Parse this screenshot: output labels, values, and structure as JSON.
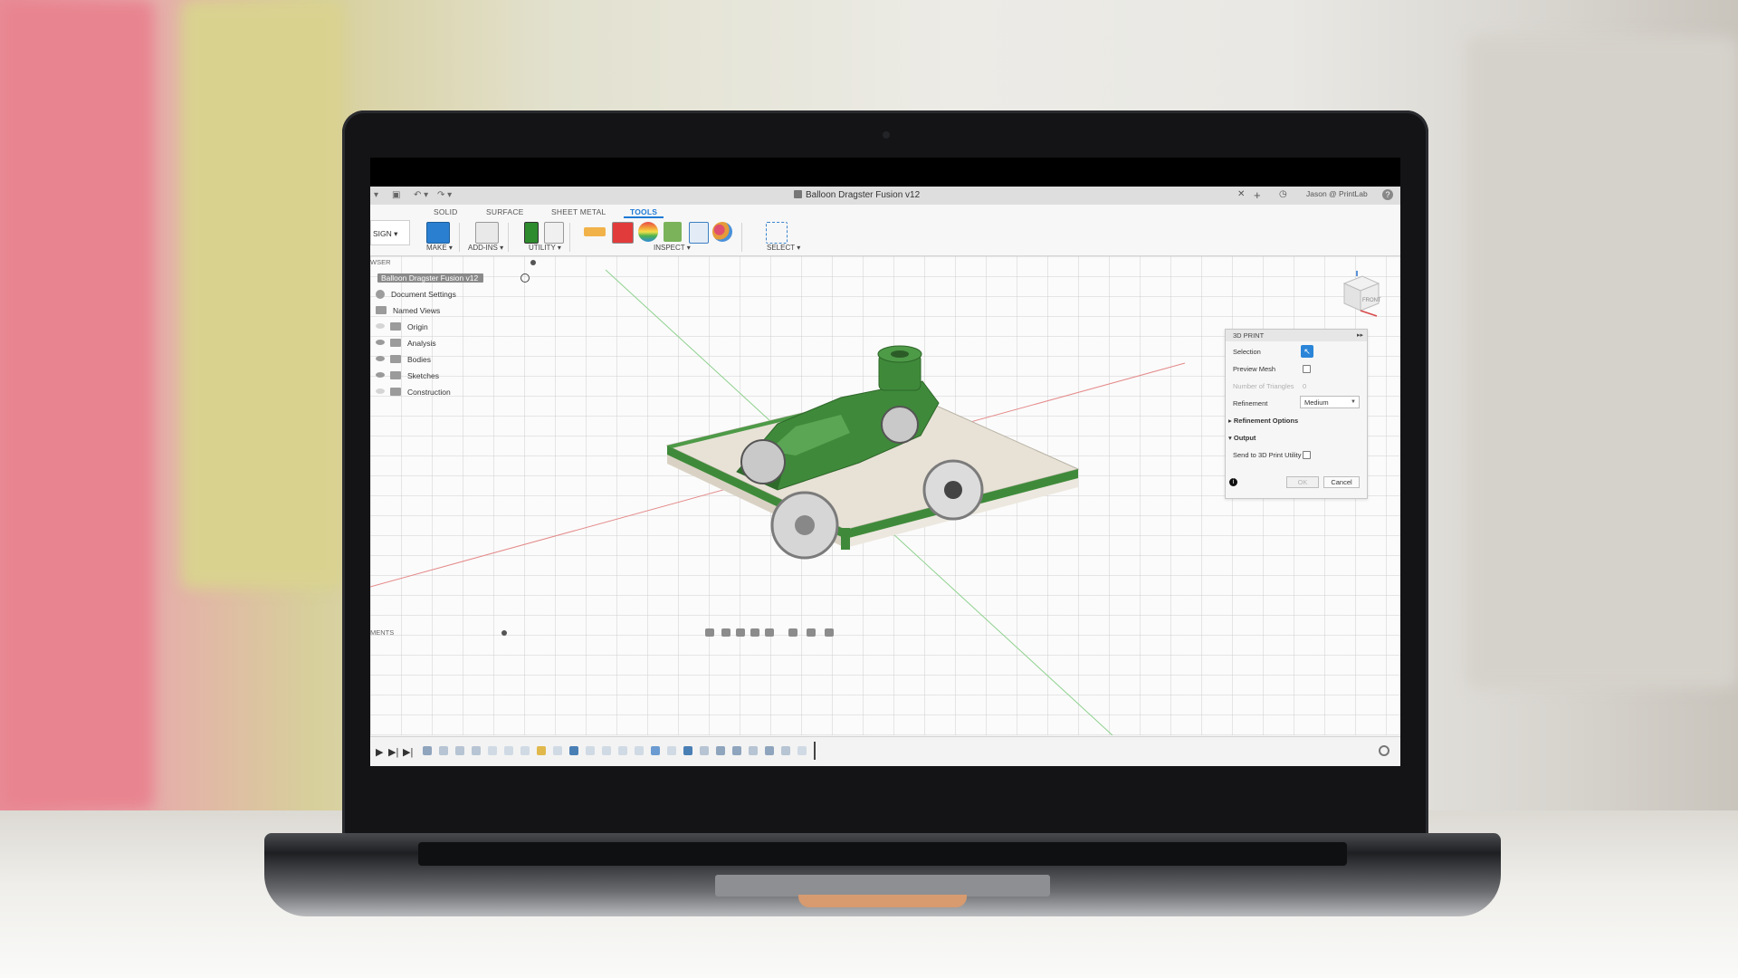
{
  "window": {
    "title": "Balloon Dragster Fusion v12",
    "user": "Jason @ PrintLab",
    "help": "?"
  },
  "ribbon": {
    "workspace": "SIGN ▾",
    "tabs": [
      "SOLID",
      "SURFACE",
      "SHEET METAL",
      "TOOLS"
    ],
    "active_tab": "TOOLS",
    "groups": [
      "MAKE ▾",
      "ADD-INS ▾",
      "UTILITY ▾",
      "INSPECT ▾",
      "SELECT ▾"
    ]
  },
  "browser": {
    "header": "WSER",
    "root": "Balloon Dragster Fusion v12",
    "items": [
      "Document Settings",
      "Named Views",
      "Origin",
      "Analysis",
      "Bodies",
      "Sketches",
      "Construction"
    ]
  },
  "panel": {
    "title": "3D PRINT",
    "selection_label": "Selection",
    "preview_mesh_label": "Preview Mesh",
    "triangles_label": "Number of Triangles",
    "triangles_value": "0",
    "refinement_label": "Refinement",
    "refinement_value": "Medium",
    "refinement_options_label": "Refinement Options",
    "output_label": "Output",
    "send_label": "Send to 3D Print Utility",
    "ok_label": "OK",
    "cancel_label": "Cancel"
  },
  "comments": {
    "label": "MENTS"
  },
  "viewcube": {
    "face": "FRONT"
  },
  "colors": {
    "accent": "#1e7ad6",
    "model_green": "#3f8a3a",
    "base_beige": "#e9e3d6"
  }
}
